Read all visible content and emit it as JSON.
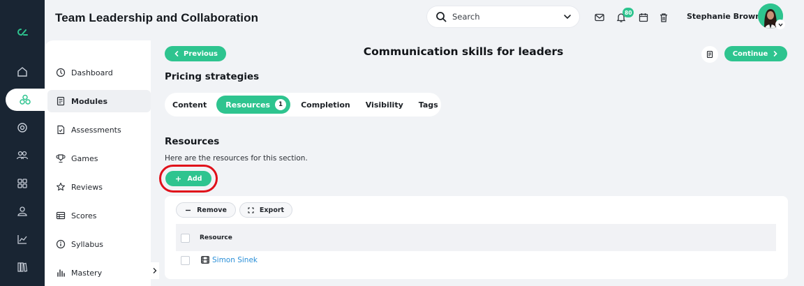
{
  "app": {
    "brand_color": "#2ec48f",
    "rail_color": "#192533",
    "rail_icons": [
      "home-icon",
      "modules-icon",
      "target-icon",
      "users-icon",
      "grid-icon",
      "person-icon",
      "chart-icon",
      "library-icon"
    ]
  },
  "header": {
    "title": "Team Leadership and Collaboration",
    "search": {
      "placeholder": "Search"
    },
    "notification_count": "80",
    "user_name": "Stephanie Brown",
    "icons": [
      "mail-icon",
      "bell-icon",
      "calendar-icon",
      "trash-icon"
    ]
  },
  "sidebar": {
    "items": [
      {
        "label": "Dashboard",
        "icon": "dashboard-icon"
      },
      {
        "label": "Modules",
        "icon": "book-icon",
        "active": true
      },
      {
        "label": "Assessments",
        "icon": "assessment-icon"
      },
      {
        "label": "Games",
        "icon": "trophy-icon"
      },
      {
        "label": "Reviews",
        "icon": "star-icon"
      },
      {
        "label": "Scores",
        "icon": "table-icon"
      },
      {
        "label": "Syllabus",
        "icon": "info-icon"
      },
      {
        "label": "Mastery",
        "icon": "bar-chart-icon"
      }
    ]
  },
  "main": {
    "previous_label": "Previous",
    "continue_label": "Continue",
    "module_title": "Communication skills for leaders",
    "section_title": "Pricing strategies",
    "tabs": [
      {
        "label": "Content"
      },
      {
        "label": "Resources",
        "count": "1",
        "active": true
      },
      {
        "label": "Completion"
      },
      {
        "label": "Visibility"
      },
      {
        "label": "Tags"
      }
    ],
    "resources": {
      "title": "Resources",
      "description": "Here are the resources for this section.",
      "add_label": "Add",
      "remove_label": "Remove",
      "export_label": "Export",
      "column_header": "Resource",
      "rows": [
        {
          "name": "Simon Sinek"
        }
      ]
    }
  }
}
